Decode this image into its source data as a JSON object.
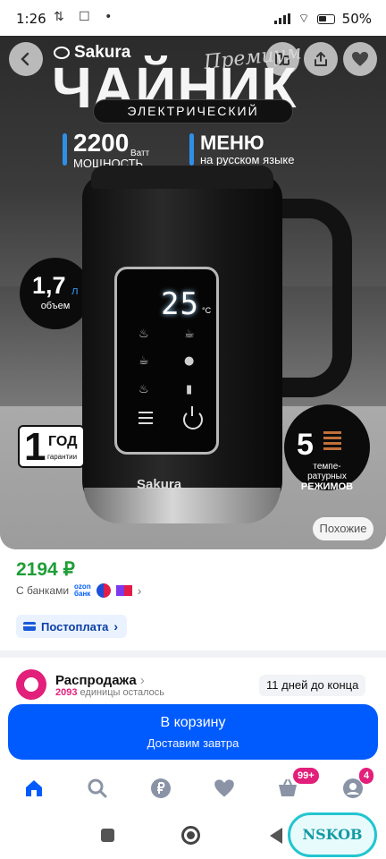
{
  "status_bar": {
    "time": "1:26",
    "battery": "50%"
  },
  "hero": {
    "brand": "Sakura",
    "script_text": "Премиум",
    "title": "ЧАЙНИК",
    "subtitle": "ЭЛЕКТРИЧЕСКИЙ",
    "power_value": "2200",
    "power_unit": "Ватт",
    "power_label": "МОЩНОСТЬ",
    "menu_title": "МЕНЮ",
    "menu_sub": "на русском языке",
    "volume_value": "1,7",
    "volume_unit": "л",
    "volume_label": "объем",
    "display_temp": "25",
    "display_unit": "°C",
    "kettle_brand": "Sakura",
    "warranty_num": "1",
    "warranty_word": "ГОД",
    "warranty_label": "гарантии",
    "modes_num": "5",
    "modes_l1": "темпе-",
    "modes_l2": "ратурных",
    "modes_l3": "РЕЖИМОВ",
    "similar_label": "Похожие"
  },
  "price": {
    "value": "2194 ₽",
    "banks_label": "С банками",
    "ozon_bank_l1": "ozon",
    "ozon_bank_l2": "банк"
  },
  "postoplata": {
    "label": "Постоплата"
  },
  "sale": {
    "title": "Распродажа",
    "count": "2093",
    "remaining": "единицы осталось",
    "days": "11 дней до конца"
  },
  "buy": {
    "label": "В корзину",
    "sub": "Доставим завтра"
  },
  "tabs": {
    "cart_badge": "99+",
    "profile_badge": "4"
  },
  "watermark": "NSKOB",
  "colors": {
    "accent": "#005bff",
    "price": "#1e9e37",
    "badge": "#e21f7a"
  }
}
